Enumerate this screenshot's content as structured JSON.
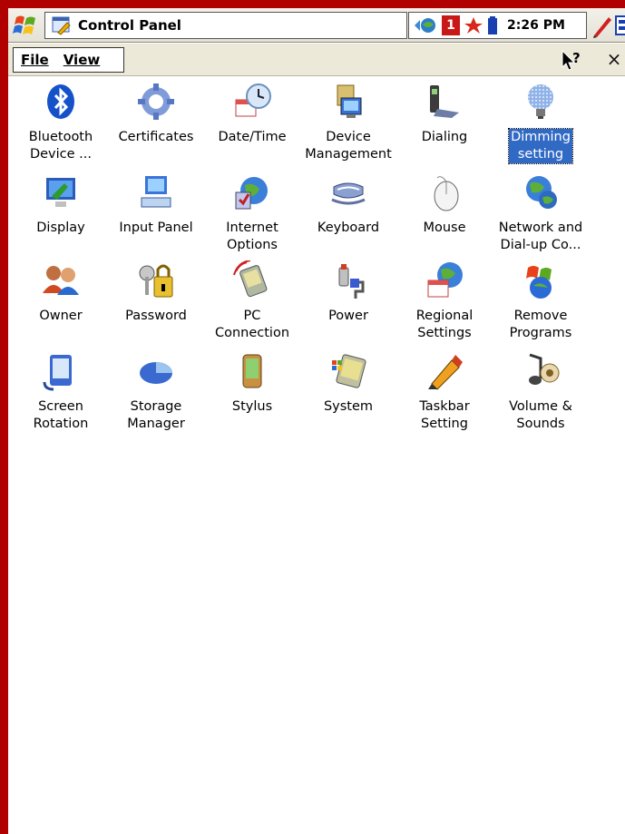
{
  "taskbar": {
    "title": "Control Panel",
    "clock": "2:26 PM",
    "tray_badge": "1"
  },
  "menu": {
    "file": "File",
    "view": "View"
  },
  "items": [
    {
      "label": "Bluetooth\nDevice ...",
      "icon": "bluetooth-icon"
    },
    {
      "label": "Certificates",
      "icon": "certificates-icon"
    },
    {
      "label": "Date/Time",
      "icon": "date-time-icon"
    },
    {
      "label": "Device\nManagement",
      "icon": "device-management-icon"
    },
    {
      "label": "Dialing",
      "icon": "dialing-icon"
    },
    {
      "label": "Dimming\nsetting",
      "icon": "dimming-icon",
      "selected": true
    },
    {
      "label": "Display",
      "icon": "display-icon"
    },
    {
      "label": "Input Panel",
      "icon": "input-panel-icon"
    },
    {
      "label": "Internet\nOptions",
      "icon": "internet-options-icon"
    },
    {
      "label": "Keyboard",
      "icon": "keyboard-icon"
    },
    {
      "label": "Mouse",
      "icon": "mouse-icon"
    },
    {
      "label": "Network and\nDial-up Co...",
      "icon": "network-icon"
    },
    {
      "label": "Owner",
      "icon": "owner-icon"
    },
    {
      "label": "Password",
      "icon": "password-icon"
    },
    {
      "label": "PC\nConnection",
      "icon": "pc-connection-icon"
    },
    {
      "label": "Power",
      "icon": "power-icon"
    },
    {
      "label": "Regional\nSettings",
      "icon": "regional-settings-icon"
    },
    {
      "label": "Remove\nPrograms",
      "icon": "remove-programs-icon"
    },
    {
      "label": "Screen\nRotation",
      "icon": "screen-rotation-icon"
    },
    {
      "label": "Storage\nManager",
      "icon": "storage-manager-icon"
    },
    {
      "label": "Stylus",
      "icon": "stylus-icon"
    },
    {
      "label": "System",
      "icon": "system-icon"
    },
    {
      "label": "Taskbar\nSetting",
      "icon": "taskbar-setting-icon"
    },
    {
      "label": "Volume &\nSounds",
      "icon": "volume-sounds-icon"
    }
  ],
  "colors": {
    "frame": "#b00000",
    "selection": "#316ac5"
  }
}
